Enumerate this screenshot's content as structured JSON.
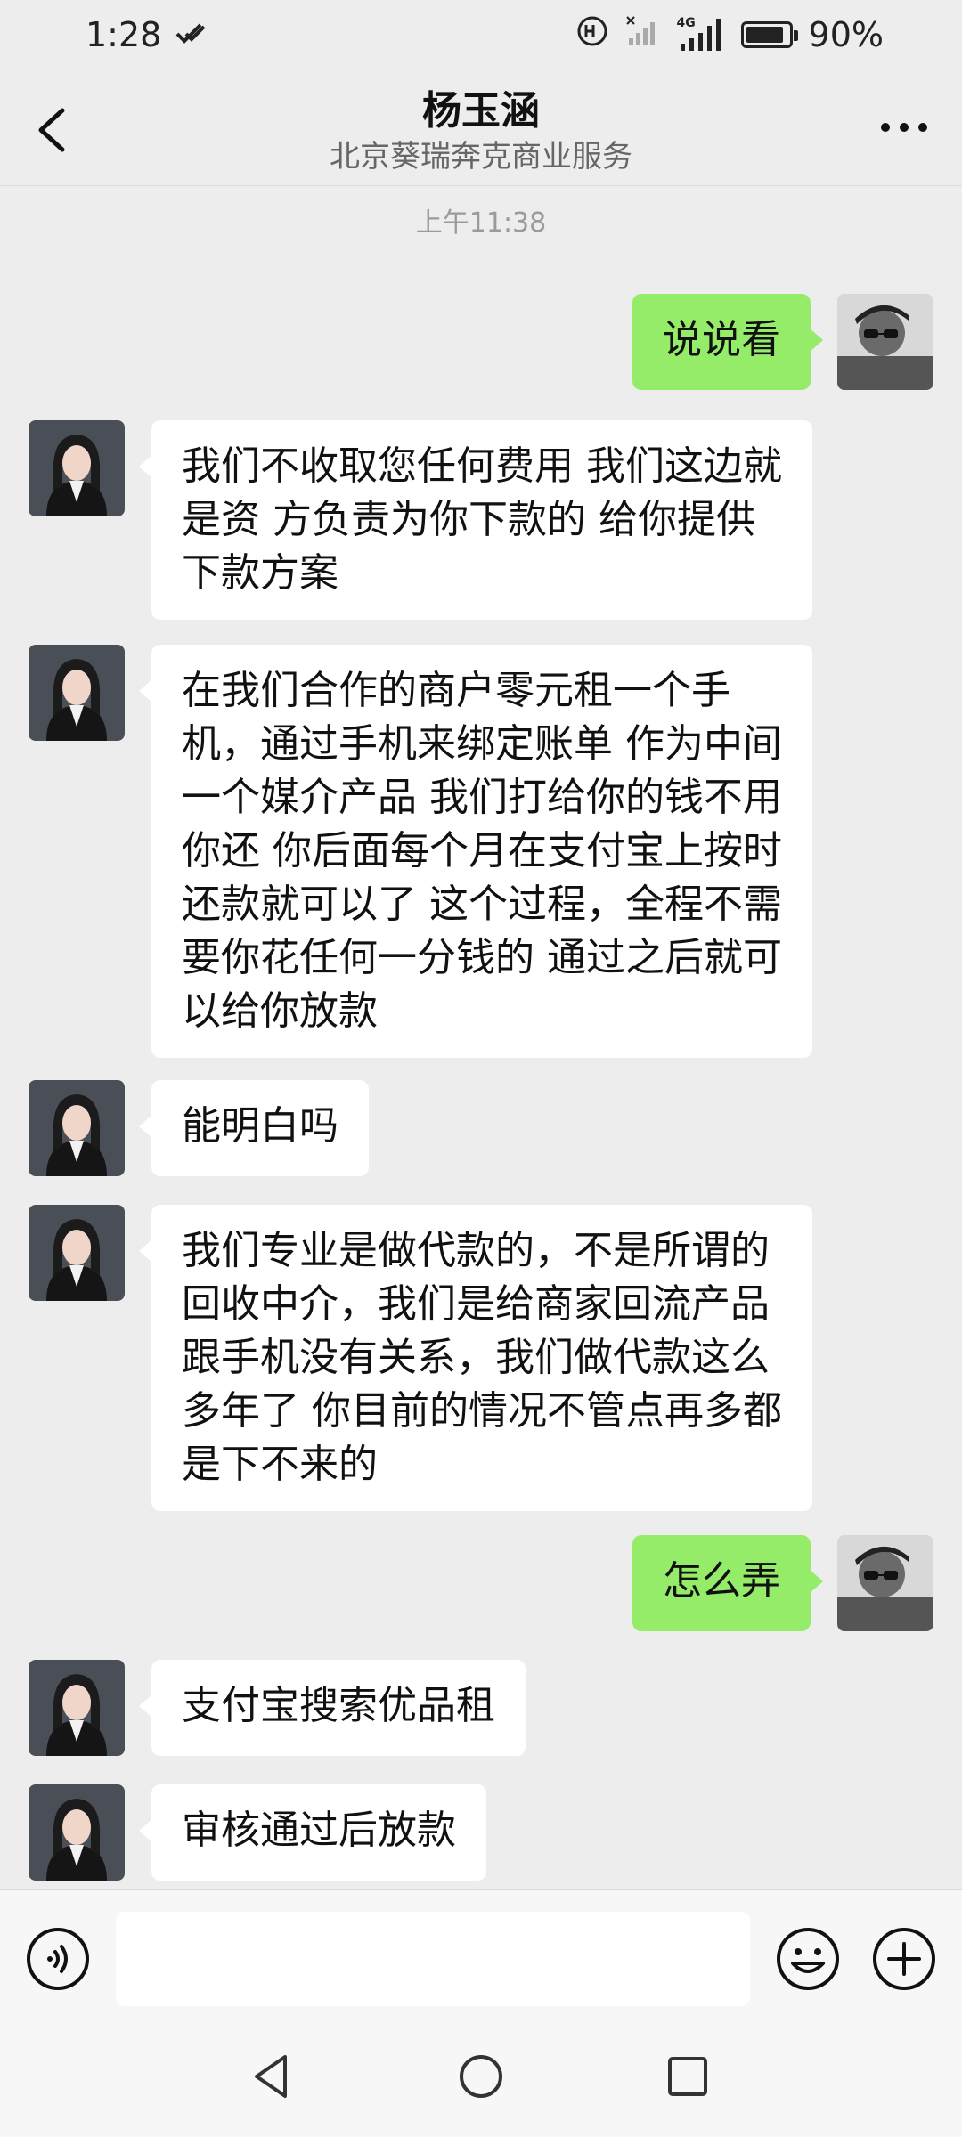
{
  "status_bar": {
    "time": "1:28",
    "battery_percent": "90%",
    "network": "4G",
    "battery_level": 0.9
  },
  "header": {
    "contact_name": "杨玉涵",
    "contact_subtitle": "北京葵瑞奔克商业服务"
  },
  "timestamp": "上午11:38",
  "messages": [
    {
      "side": "out",
      "text": "说说看"
    },
    {
      "side": "in",
      "text": "我们不收取您任何费用 我们这边就是资 方负责为你下款的 给你提供下款方案"
    },
    {
      "side": "in",
      "text": "在我们合作的商户零元租一个手机，通过手机来绑定账单 作为中间一个媒介产品 我们打给你的钱不用你还 你后面每个月在支付宝上按时还款就可以了 这个过程，全程不需要你花任何一分钱的 通过之后就可以给你放款"
    },
    {
      "side": "in",
      "text": "能明白吗"
    },
    {
      "side": "in",
      "text": "我们专业是做代款的，不是所谓的回收中介，我们是给商家回流产品跟手机没有关系，我们做代款这么多年了 你目前的情况不管点再多都是下不来的"
    },
    {
      "side": "out",
      "text": "怎么弄"
    },
    {
      "side": "in",
      "text": "支付宝搜索优品租"
    },
    {
      "side": "in",
      "text": "审核通过后放款"
    }
  ],
  "input": {
    "value": "",
    "placeholder": ""
  },
  "icons": {
    "back": "chevron-left-icon",
    "more": "more-dots-icon",
    "voice": "voice-icon",
    "emoji": "emoji-icon",
    "plus": "plus-icon",
    "nav_back": "triangle-back-icon",
    "nav_home": "circle-home-icon",
    "nav_recent": "square-recent-icon"
  },
  "colors": {
    "background": "#ededed",
    "outgoing_bubble": "#95ec69",
    "incoming_bubble": "#ffffff"
  }
}
